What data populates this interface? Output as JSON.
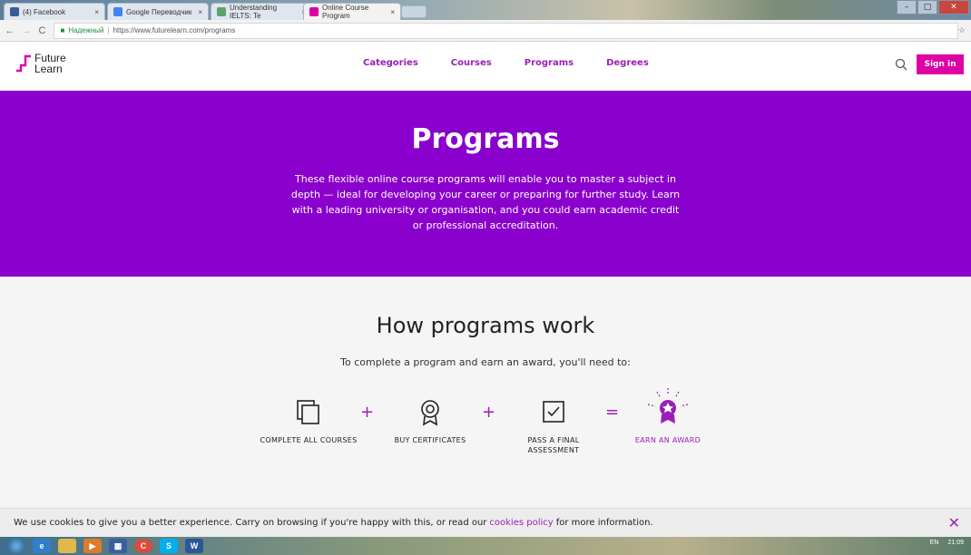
{
  "browser": {
    "tabs": [
      {
        "label": "(4) Facebook"
      },
      {
        "label": "Google Переводчик"
      },
      {
        "label": "Understanding IELTS: Te"
      },
      {
        "label": "Online Course Program"
      }
    ],
    "secure_label": "Надежный",
    "url": "https://www.futurelearn.com/programs"
  },
  "header": {
    "logo_line1": "Future",
    "logo_line2": "Learn",
    "nav": [
      "Categories",
      "Courses",
      "Programs",
      "Degrees"
    ],
    "signin_label": "Sign in"
  },
  "hero": {
    "title": "Programs",
    "description": "These flexible online course programs will enable you to master a subject in depth — ideal for developing your career or preparing for further study. Learn with a leading university or organisation, and you could earn academic credit or professional accreditation."
  },
  "how": {
    "title": "How programs work",
    "subtitle": "To complete a program and earn an award, you'll need to:",
    "steps": [
      {
        "label": "COMPLETE ALL COURSES",
        "icon": "courses-icon"
      },
      {
        "label": "BUY CERTIFICATES",
        "icon": "certificate-icon"
      },
      {
        "label": "PASS A FINAL ASSESSMENT",
        "icon": "assessment-icon"
      },
      {
        "label": "EARN AN AWARD",
        "icon": "award-icon"
      }
    ],
    "operators": [
      "+",
      "+",
      "="
    ]
  },
  "cookie": {
    "text_before": "We use cookies to give you a better experience. Carry on browsing if you're happy with this, or read our",
    "link": "cookies policy",
    "text_after": "for more information.",
    "close": "✕"
  },
  "taskbar": {
    "lang": "EN",
    "time": "21:09"
  },
  "colors": {
    "brand_purple": "#8a00cc",
    "accent_pink": "#de00a5",
    "link_purple": "#9b1fb7"
  }
}
